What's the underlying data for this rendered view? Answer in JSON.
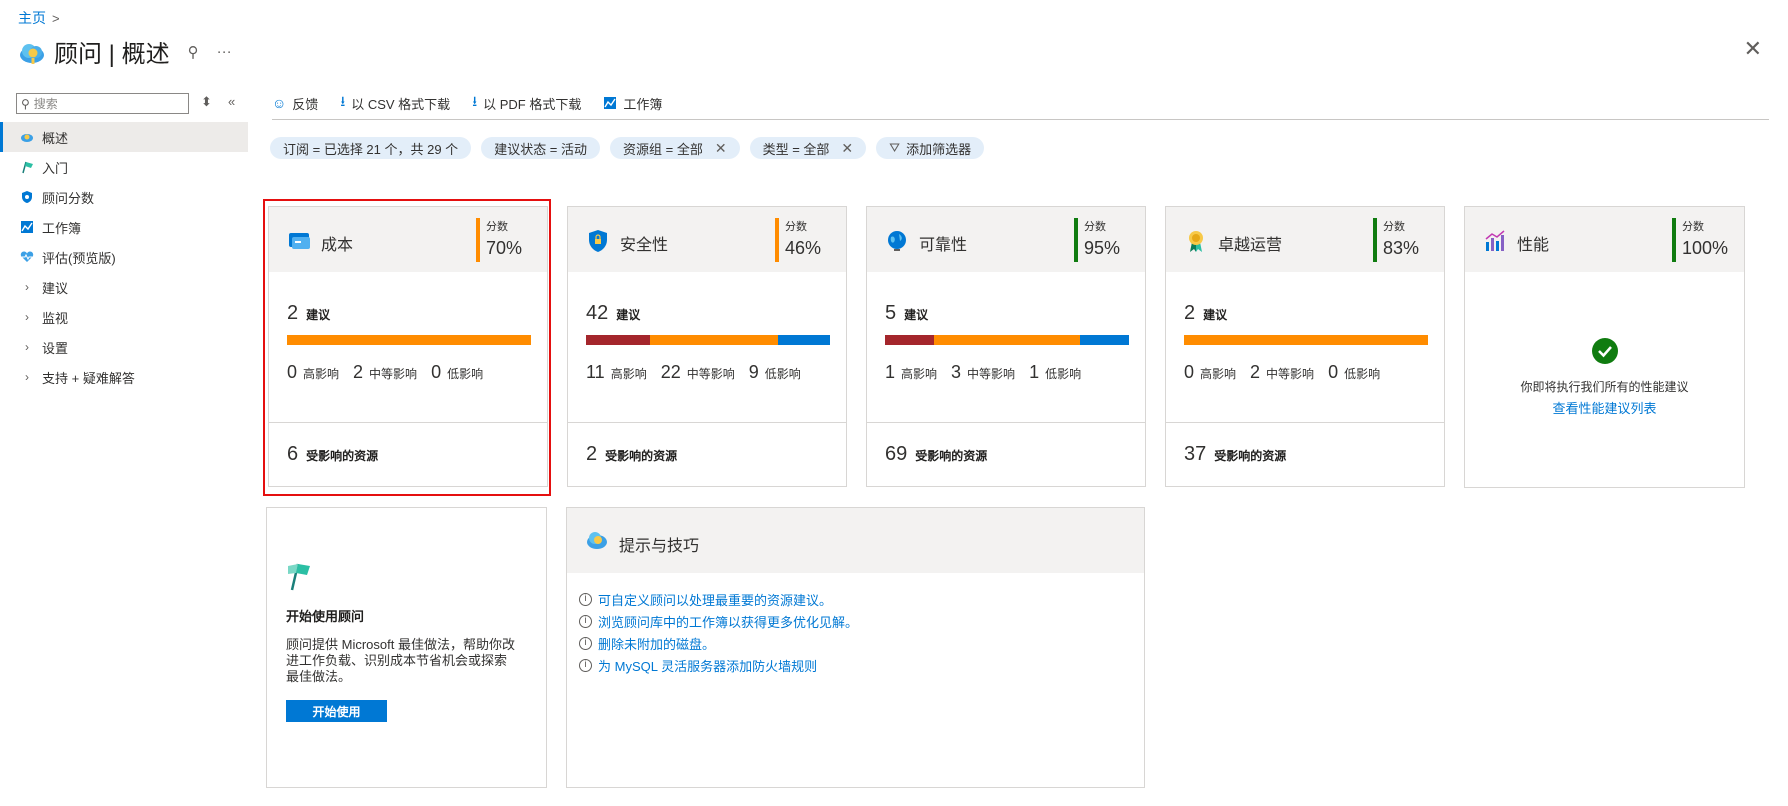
{
  "breadcrumb": {
    "home": "主页",
    "sep": ">"
  },
  "title": {
    "text": "顾问 | 概述",
    "pin": "⚲",
    "more": "···",
    "close": "✕"
  },
  "sidebar": {
    "search_placeholder": "搜索",
    "items": [
      {
        "label": "概述",
        "icon": "advisor-cloud-icon",
        "active": true
      },
      {
        "label": "入门",
        "icon": "flag-icon"
      },
      {
        "label": "顾问分数",
        "icon": "shield-score-icon"
      },
      {
        "label": "工作簿",
        "icon": "workbook-icon"
      },
      {
        "label": "评估(预览版)",
        "icon": "heart-pulse-icon"
      },
      {
        "label": "建议",
        "expandable": true
      },
      {
        "label": "监视",
        "expandable": true
      },
      {
        "label": "设置",
        "expandable": true
      },
      {
        "label": "支持 + 疑难解答",
        "expandable": true
      }
    ]
  },
  "toolbar": {
    "feedback": "反馈",
    "download_csv": "以 CSV 格式下载",
    "download_pdf": "以 PDF 格式下载",
    "workbook": "工作簿"
  },
  "filters": [
    {
      "label": "订阅 = 已选择 21 个，共 29 个",
      "removable": false
    },
    {
      "label": "建议状态 = 活动",
      "removable": false
    },
    {
      "label": "资源组 = 全部",
      "removable": true
    },
    {
      "label": "类型 = 全部",
      "removable": true
    },
    {
      "label": "添加筛选器",
      "add": true
    }
  ],
  "colors": {
    "high": "#a4262c",
    "medium": "#ff8c00",
    "low": "#0078d4",
    "score_orange": "#ff8c00",
    "score_green": "#107c10"
  },
  "score_label": "分数",
  "rec_label": "建议",
  "affected_label": "受影响的资源",
  "impact_labels": {
    "high": "高影响",
    "medium": "中等影响",
    "low": "低影响"
  },
  "cards": [
    {
      "name": "成本",
      "score": "70%",
      "rec": "2",
      "high": "0",
      "medium": "2",
      "low": "0",
      "affected": "6"
    },
    {
      "name": "安全性",
      "score": "46%",
      "rec": "42",
      "high": "11",
      "medium": "22",
      "low": "9",
      "affected": "2"
    },
    {
      "name": "可靠性",
      "score": "95%",
      "rec": "5",
      "high": "1",
      "medium": "3",
      "low": "1",
      "affected": "69"
    },
    {
      "name": "卓越运营",
      "score": "83%",
      "rec": "2",
      "high": "0",
      "medium": "2",
      "low": "0",
      "affected": "37"
    },
    {
      "name": "性能",
      "score": "100%",
      "all_done": "你即将执行我们所有的性能建议",
      "link": "查看性能建议列表"
    }
  ],
  "get_started": {
    "title": "开始使用顾问",
    "desc": "顾问提供 Microsoft 最佳做法，帮助你改进工作负载、识别成本节省机会或探索最佳做法。",
    "button": "开始使用"
  },
  "tips": {
    "title": "提示与技巧",
    "items": [
      "可自定义顾问以处理最重要的资源建议。",
      "浏览顾问库中的工作簿以获得更多优化见解。",
      "删除未附加的磁盘。",
      "为 MySQL 灵活服务器添加防火墙规则"
    ]
  }
}
